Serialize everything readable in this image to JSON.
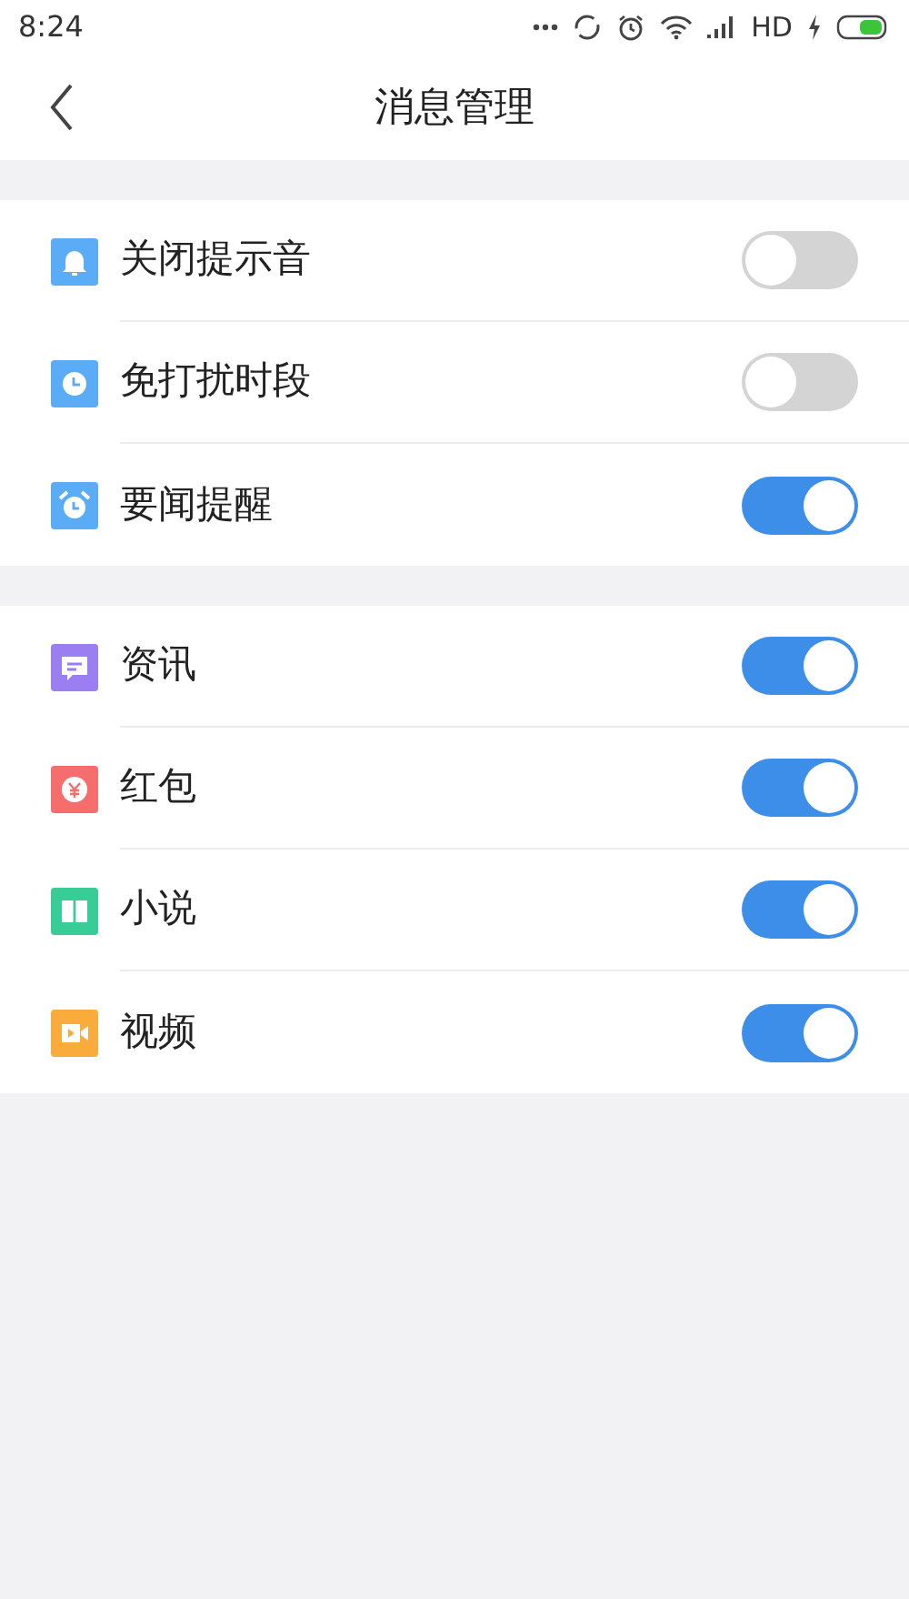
{
  "status_bar": {
    "time": "8:24",
    "network": "HD"
  },
  "header": {
    "title": "消息管理"
  },
  "groups": [
    {
      "items": [
        {
          "label": "关闭提示音",
          "color": "#5aacf7",
          "on": false
        },
        {
          "label": "免打扰时段",
          "color": "#5aacf7",
          "on": false
        },
        {
          "label": "要闻提醒",
          "color": "#5aacf7",
          "on": true
        }
      ]
    },
    {
      "items": [
        {
          "label": "资讯",
          "color": "#9b7ef2",
          "on": true
        },
        {
          "label": "红包",
          "color": "#f66d6d",
          "on": true
        },
        {
          "label": "小说",
          "color": "#38cc97",
          "on": true
        },
        {
          "label": "视频",
          "color": "#f9ab3c",
          "on": true
        }
      ]
    }
  ]
}
